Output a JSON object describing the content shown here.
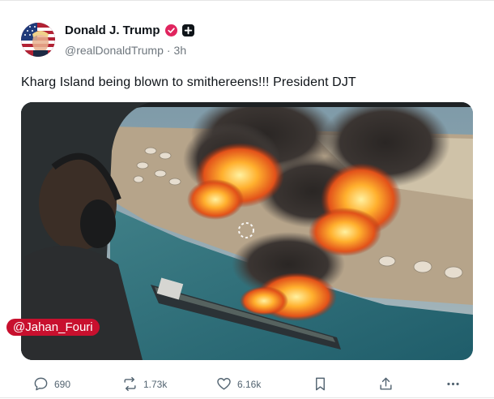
{
  "author": {
    "name": "Donald J. Trump",
    "handle": "@realDonaldTrump",
    "separator": "·",
    "time": "3h",
    "avatar_icon": "flag-portrait-avatar",
    "verified_color": "#e0245e"
  },
  "post": {
    "text": "Kharg Island being blown to smithereens!!! President DJT"
  },
  "media": {
    "description_icon": "burning-oil-terminal-image",
    "watermark": "@Jahan_Fouri",
    "loading_icon": "spinner-icon"
  },
  "actions": {
    "replies": "690",
    "reposts": "1.73k",
    "likes": "6.16k"
  },
  "colors": {
    "text_primary": "#0f1419",
    "text_secondary": "#6e767d",
    "watermark_bg": "#c8102e"
  }
}
